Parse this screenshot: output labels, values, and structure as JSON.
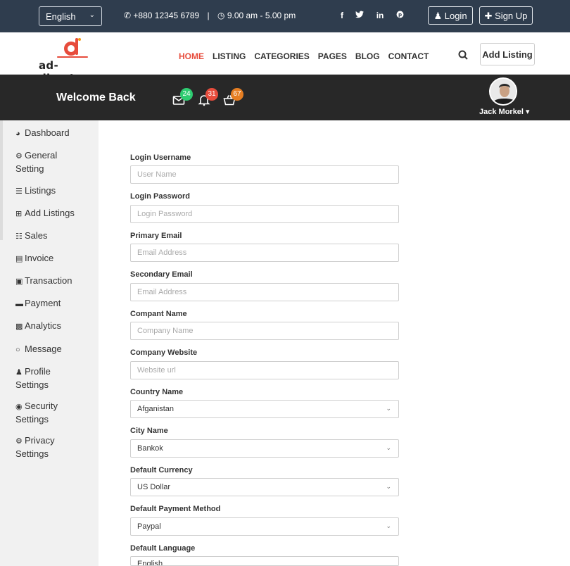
{
  "topbar": {
    "language": "English",
    "phone": "+880 12345 6789",
    "hours": "9.00 am - 5.00 pm",
    "socials": [
      "f",
      "t",
      "in",
      "p"
    ],
    "login_label": "Login",
    "signup_label": "Sign Up"
  },
  "nav": {
    "logo_text": "ad-directory",
    "links": [
      "HOME",
      "LISTING",
      "CATEGORIES",
      "PAGES",
      "BLOG",
      "CONTACT"
    ],
    "add_listing": "Add Listing"
  },
  "dashboard": {
    "welcome": "Welcome Back",
    "badges": {
      "messages": "24",
      "notifications": "31",
      "cart": "67"
    },
    "user_name": "Jack Morkel"
  },
  "sidebar": {
    "items": [
      {
        "label": "Dashboard",
        "icon": "dashboard-icon"
      },
      {
        "label": "General Setting",
        "icon": "gear-icon"
      },
      {
        "label": "Listings",
        "icon": "list-icon"
      },
      {
        "label": "Add Listings",
        "icon": "plus-square-icon"
      },
      {
        "label": "Sales",
        "icon": "cart-icon"
      },
      {
        "label": "Invoice",
        "icon": "file-icon"
      },
      {
        "label": "Transaction",
        "icon": "money-icon"
      },
      {
        "label": "Payment",
        "icon": "credit-card-icon"
      },
      {
        "label": "Analytics",
        "icon": "bar-chart-icon"
      },
      {
        "label": "Message",
        "icon": "comment-icon"
      },
      {
        "label": "Profile Settings",
        "icon": "user-icon"
      },
      {
        "label": "Security Settings",
        "icon": "lock-icon"
      },
      {
        "label": "Privacy Settings",
        "icon": "gear-icon"
      }
    ]
  },
  "form": {
    "username": {
      "label": "Login Username",
      "placeholder": "User Name"
    },
    "password": {
      "label": "Login Password",
      "placeholder": "Login Password"
    },
    "primary_email": {
      "label": "Primary Email",
      "placeholder": "Email Address"
    },
    "secondary_email": {
      "label": "Secondary Email",
      "placeholder": "Email Address"
    },
    "company_name": {
      "label": "Compant Name",
      "placeholder": "Company Name"
    },
    "company_website": {
      "label": "Company Website",
      "placeholder": "Website url"
    },
    "country": {
      "label": "Country Name",
      "value": "Afganistan"
    },
    "city": {
      "label": "City Name",
      "value": "Bankok"
    },
    "currency": {
      "label": "Default Currency",
      "value": "US Dollar"
    },
    "payment_method": {
      "label": "Default Payment Method",
      "value": "Paypal"
    },
    "language": {
      "label": "Default Language",
      "value": "English"
    }
  },
  "colors": {
    "topbar_bg": "#2f3d4e",
    "accent": "#e74c3c",
    "header_bg": "#282828",
    "badge_green": "#2ecc71",
    "badge_red": "#e74c3c",
    "badge_orange": "#e67e22"
  }
}
